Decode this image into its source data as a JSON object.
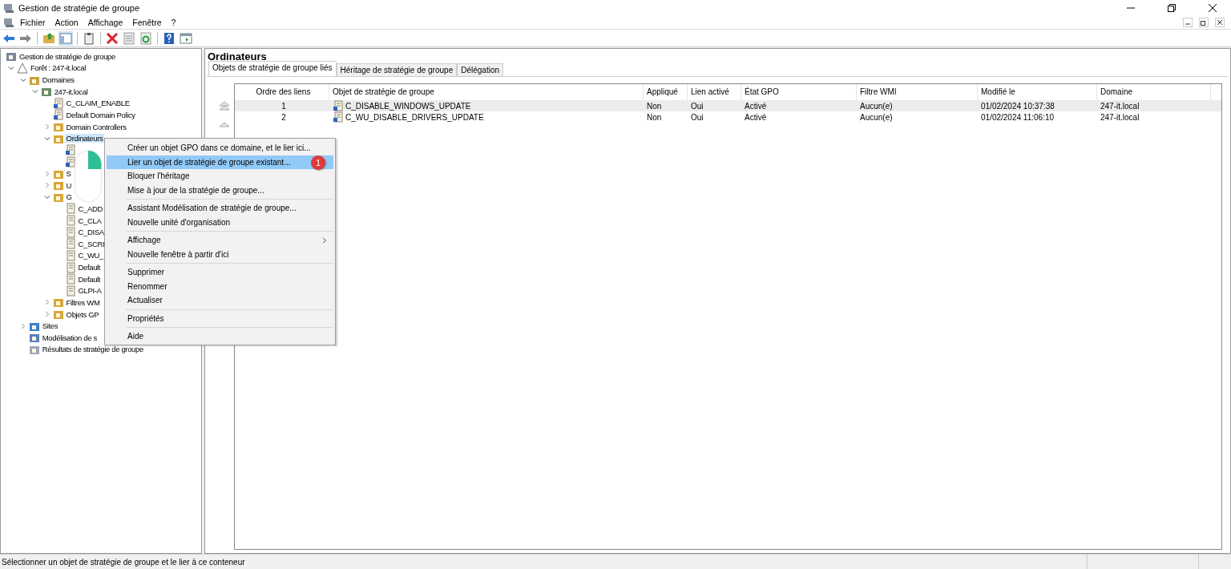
{
  "window": {
    "title": "Gestion de stratégie de groupe"
  },
  "menu_bar": [
    "Fichier",
    "Action",
    "Affichage",
    "Fenêtre",
    "?"
  ],
  "tree": [
    {
      "label": "Gestion de stratégie de groupe",
      "kind": "console",
      "selected": false,
      "children": [
        {
          "label": "Forêt : 247-it.local",
          "kind": "forest",
          "selected": false,
          "expanded": true,
          "children": [
            {
              "label": "Domaines",
              "kind": "domains",
              "selected": false,
              "expanded": true,
              "children": [
                {
                  "label": "247-it.local",
                  "kind": "domain",
                  "selected": false,
                  "expanded": true,
                  "children": [
                    {
                      "label": "C_CLAIM_ENABLE",
                      "kind": "link",
                      "selected": false
                    },
                    {
                      "label": "Default Domain Policy",
                      "kind": "link",
                      "selected": false
                    },
                    {
                      "label": "Domain Controllers",
                      "kind": "ou",
                      "selected": false,
                      "expanded": false
                    },
                    {
                      "label": "Ordinateurs",
                      "kind": "ou",
                      "selected": true,
                      "expanded": true,
                      "children": [
                        {
                          "kind": "link"
                        },
                        {
                          "kind": "link"
                        }
                      ]
                    },
                    {
                      "label": "S",
                      "kind": "ou",
                      "selected": false,
                      "expanded": false
                    },
                    {
                      "label": "U",
                      "kind": "ou",
                      "selected": false,
                      "expanded": false
                    },
                    {
                      "label": "G",
                      "kind": "container",
                      "selected": false,
                      "expanded": true,
                      "children": [
                        {
                          "label": "C_ADD",
                          "kind": "gpo",
                          "selected": false
                        },
                        {
                          "label": "C_CLA",
                          "kind": "gpo",
                          "selected": false
                        },
                        {
                          "label": "C_DISA",
                          "kind": "gpo",
                          "selected": false
                        },
                        {
                          "label": "C_SCRI",
                          "kind": "gpo",
                          "selected": false
                        },
                        {
                          "label": "C_WU_",
                          "kind": "gpo",
                          "selected": false
                        },
                        {
                          "label": "Default",
                          "kind": "gpo",
                          "selected": false
                        },
                        {
                          "label": "Default",
                          "kind": "gpo",
                          "selected": false
                        },
                        {
                          "label": "GLPI-A",
                          "kind": "gpo",
                          "selected": false
                        }
                      ]
                    },
                    {
                      "label": "Filtres WM",
                      "kind": "container",
                      "selected": false,
                      "expanded": false
                    },
                    {
                      "label": "Objets GP",
                      "kind": "container",
                      "selected": false,
                      "expanded": false
                    }
                  ]
                }
              ]
            },
            {
              "label": "Sites",
              "kind": "sites",
              "selected": false,
              "expanded": false
            },
            {
              "label": "Modélisation de s",
              "kind": "modeling",
              "selected": false
            },
            {
              "label": "Résultats de stratégie de groupe",
              "kind": "results",
              "selected": false
            }
          ]
        }
      ]
    }
  ],
  "panel": {
    "title": "Ordinateurs",
    "tabs": [
      {
        "label": "Objets de stratégie de groupe liés",
        "selected": true
      },
      {
        "label": "Héritage de stratégie de groupe",
        "selected": false
      },
      {
        "label": "Délégation",
        "selected": false
      }
    ],
    "table": {
      "columns": [
        "Ordre des liens",
        "Objet de stratégie de groupe",
        "Appliqué",
        "Lien activé",
        "État GPO",
        "Filtre WMI",
        "Modifié le",
        "Domaine"
      ],
      "rows": [
        {
          "selected": true,
          "cells": [
            "1",
            "C_DISABLE_WINDOWS_UPDATE",
            "Non",
            "Oui",
            "Activé",
            "Aucun(e)",
            "01/02/2024 10:37:38",
            "247-it.local"
          ]
        },
        {
          "selected": false,
          "cells": [
            "2",
            "C_WU_DISABLE_DRIVERS_UPDATE",
            "Non",
            "Oui",
            "Activé",
            "Aucun(e)",
            "01/02/2024 11:06:10",
            "247-it.local"
          ]
        }
      ]
    }
  },
  "context_menu": {
    "items": [
      {
        "kind": "item",
        "label": "Créer un objet GPO dans ce domaine, et le lier ici...",
        "selected": false
      },
      {
        "kind": "item",
        "label": "Lier un objet de stratégie de groupe existant...",
        "selected": true,
        "badge": "1"
      },
      {
        "kind": "item",
        "label": "Bloquer l'héritage",
        "selected": false
      },
      {
        "kind": "item",
        "label": "Mise à jour de la stratégie de groupe...",
        "selected": false
      },
      {
        "kind": "separator"
      },
      {
        "kind": "item",
        "label": "Assistant Modélisation de stratégie de groupe...",
        "selected": false
      },
      {
        "kind": "item",
        "label": "Nouvelle unité d'organisation",
        "selected": false
      },
      {
        "kind": "separator"
      },
      {
        "kind": "submenu",
        "label": "Affichage",
        "selected": false
      },
      {
        "kind": "item",
        "label": "Nouvelle fenêtre à partir d'ici",
        "selected": false
      },
      {
        "kind": "separator"
      },
      {
        "kind": "item",
        "label": "Supprimer",
        "selected": false
      },
      {
        "kind": "item",
        "label": "Renommer",
        "selected": false
      },
      {
        "kind": "item",
        "label": "Actualiser",
        "selected": false
      },
      {
        "kind": "separator"
      },
      {
        "kind": "item",
        "label": "Propriétés",
        "selected": false
      },
      {
        "kind": "separator"
      },
      {
        "kind": "item",
        "label": "Aide",
        "selected": false
      }
    ]
  },
  "status_bar": "Sélectionner un objet de stratégie de groupe et le lier à ce conteneur"
}
